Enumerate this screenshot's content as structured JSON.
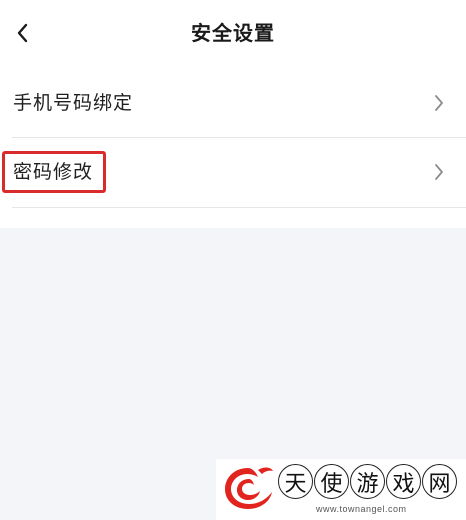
{
  "header": {
    "title": "安全设置",
    "back_icon": "chevron-left-icon"
  },
  "settings_list": {
    "items": [
      {
        "label": "手机号码绑定",
        "icon": "chevron-right-icon"
      },
      {
        "label": "密码修改",
        "icon": "chevron-right-icon",
        "highlighted": true
      }
    ]
  },
  "watermark": {
    "characters": [
      "天",
      "使",
      "游",
      "戏",
      "网"
    ],
    "url": "www.townangel.com",
    "logo_color": "#e2241f"
  },
  "colors": {
    "highlight_border": "#d92b2b",
    "page_background": "#f4f5f8",
    "card_background": "#ffffff"
  }
}
